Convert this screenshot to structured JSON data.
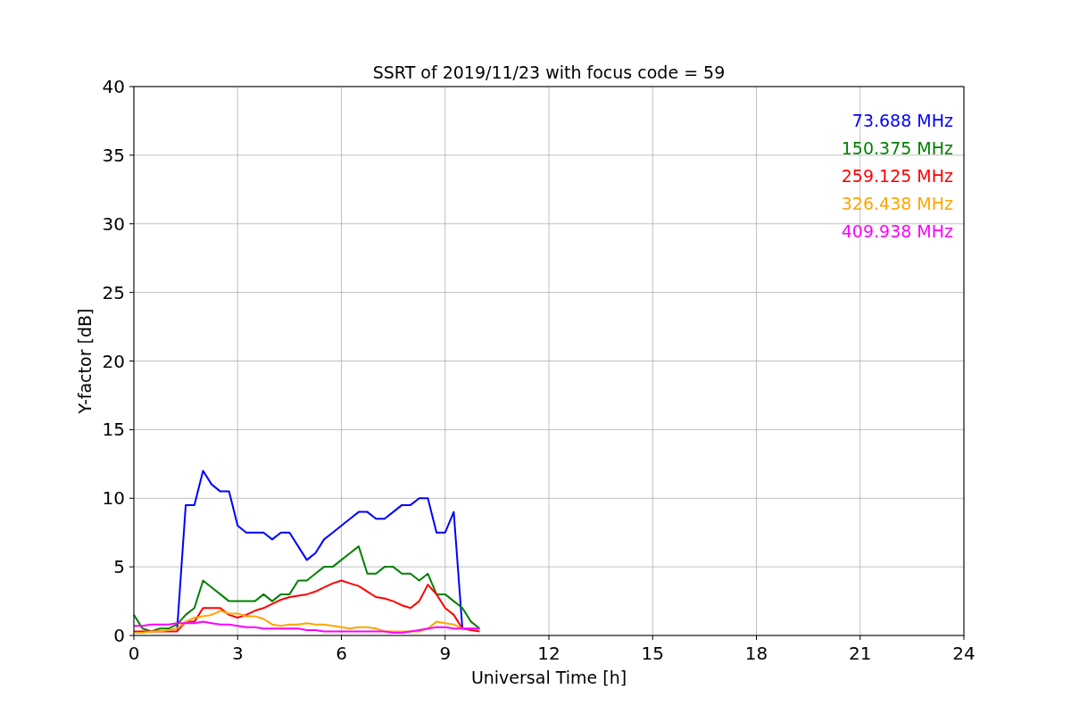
{
  "chart_data": {
    "type": "line",
    "title": "SSRT of 2019/11/23 with focus code = 59",
    "xlabel": "Universal Time [h]",
    "ylabel": "Y-factor [dB]",
    "x": [
      0,
      0.25,
      0.5,
      0.75,
      1,
      1.25,
      1.5,
      1.75,
      2,
      2.25,
      2.5,
      2.75,
      3,
      3.25,
      3.5,
      3.75,
      4,
      4.25,
      4.5,
      4.75,
      5,
      5.25,
      5.5,
      5.75,
      6,
      6.25,
      6.5,
      6.75,
      7,
      7.25,
      7.5,
      7.75,
      8,
      8.25,
      8.5,
      8.75,
      9,
      9.25,
      9.5,
      9.75,
      10
    ],
    "series": [
      {
        "name": "73.688 MHz",
        "color": "#0000ff",
        "values": [
          null,
          null,
          null,
          null,
          null,
          0.4,
          9.5,
          9.5,
          12,
          11,
          10.5,
          10.5,
          8,
          7.5,
          7.5,
          7.5,
          7,
          7.5,
          7.5,
          6.5,
          5.5,
          6,
          7,
          7.5,
          8,
          8.5,
          9,
          9,
          8.5,
          8.5,
          9,
          9.5,
          9.5,
          10,
          10,
          7.5,
          7.5,
          9,
          0.5,
          null,
          null
        ]
      },
      {
        "name": "150.375 MHz",
        "color": "#008000",
        "values": [
          1.5,
          0.5,
          0.3,
          0.5,
          0.5,
          0.8,
          1.5,
          2,
          4,
          3.5,
          3,
          2.5,
          2.5,
          2.5,
          2.5,
          3,
          2.5,
          3,
          3,
          4,
          4,
          4.5,
          5,
          5,
          5.5,
          6,
          6.5,
          4.5,
          4.5,
          5,
          5,
          4.5,
          4.5,
          4,
          4.5,
          3,
          3,
          2.5,
          2,
          1,
          0.5
        ]
      },
      {
        "name": "259.125 MHz",
        "color": "#ff0000",
        "values": [
          0.3,
          0.3,
          0.3,
          0.3,
          0.3,
          0.3,
          1,
          1,
          2,
          2,
          2,
          1.5,
          1.3,
          1.5,
          1.8,
          2,
          2.3,
          2.6,
          2.8,
          2.9,
          3,
          3.2,
          3.5,
          3.8,
          4,
          3.8,
          3.6,
          3.2,
          2.8,
          2.7,
          2.5,
          2.2,
          2,
          2.5,
          3.7,
          3,
          2,
          1.5,
          0.5,
          0.4,
          0.3
        ]
      },
      {
        "name": "326.438 MHz",
        "color": "#ffa500",
        "values": [
          0.2,
          0.2,
          0.3,
          0.3,
          0.4,
          0.5,
          1,
          1.3,
          1.4,
          1.5,
          1.8,
          1.6,
          1.6,
          1.4,
          1.4,
          1.2,
          0.8,
          0.7,
          0.8,
          0.8,
          0.9,
          0.8,
          0.8,
          0.7,
          0.6,
          0.5,
          0.6,
          0.6,
          0.5,
          0.3,
          0.3,
          0.3,
          0.3,
          0.3,
          0.5,
          1,
          0.9,
          0.8,
          0.5,
          0.5,
          0.5
        ]
      },
      {
        "name": "409.938 MHz",
        "color": "#ff00ff",
        "values": [
          0.7,
          0.7,
          0.8,
          0.8,
          0.8,
          0.9,
          0.9,
          0.9,
          1,
          0.9,
          0.8,
          0.8,
          0.7,
          0.6,
          0.6,
          0.5,
          0.5,
          0.5,
          0.5,
          0.5,
          0.4,
          0.4,
          0.3,
          0.3,
          0.3,
          0.3,
          0.3,
          0.3,
          0.3,
          0.3,
          0.2,
          0.2,
          0.3,
          0.4,
          0.5,
          0.6,
          0.6,
          0.5,
          0.5,
          0.5,
          0.5
        ]
      }
    ],
    "grid": true,
    "xlim": [
      0,
      24
    ],
    "ylim": [
      0,
      40
    ],
    "xticks": [
      0,
      3,
      6,
      9,
      12,
      15,
      18,
      21,
      24
    ],
    "yticks": [
      0,
      5,
      10,
      15,
      20,
      25,
      30,
      35,
      40
    ]
  }
}
